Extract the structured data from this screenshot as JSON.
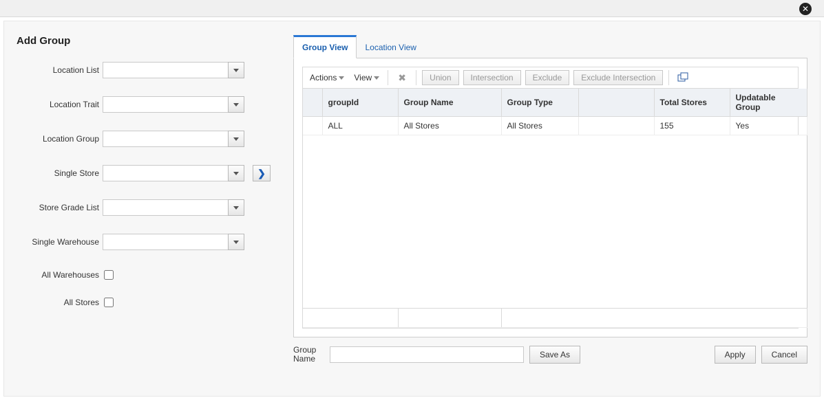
{
  "title": "Add Group",
  "form": {
    "location_list_label": "Location List",
    "location_trait_label": "Location Trait",
    "location_group_label": "Location Group",
    "single_store_label": "Single Store",
    "store_grade_list_label": "Store Grade List",
    "single_warehouse_label": "Single Warehouse",
    "all_warehouses_label": "All Warehouses",
    "all_stores_label": "All Stores"
  },
  "tabs": {
    "group_view": "Group View",
    "location_view": "Location View"
  },
  "toolbar": {
    "actions": "Actions",
    "view": "View",
    "union": "Union",
    "intersection": "Intersection",
    "exclude": "Exclude",
    "exclude_intersection": "Exclude Intersection"
  },
  "grid": {
    "columns": {
      "groupId": "groupId",
      "group_name": "Group Name",
      "group_type": "Group Type",
      "blank": "",
      "total_stores": "Total Stores",
      "updatable_group": "Updatable Group"
    },
    "rows": [
      {
        "groupId": "ALL",
        "group_name": "All Stores",
        "group_type": "All Stores",
        "blank": "",
        "total_stores": "155",
        "updatable_group": "Yes"
      }
    ]
  },
  "bottom": {
    "group_name_label": "Group Name",
    "save_as": "Save As",
    "apply": "Apply",
    "cancel": "Cancel"
  }
}
